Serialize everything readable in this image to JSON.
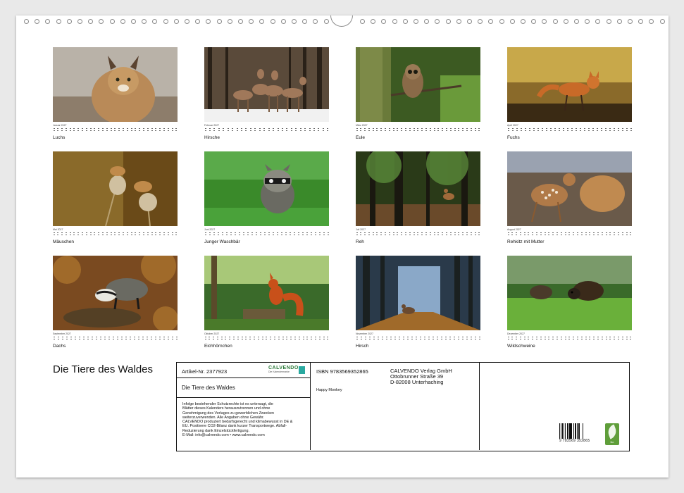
{
  "calendar": {
    "title": "Die Tiere des Waldes",
    "months": [
      {
        "month": "Januar 2027",
        "caption": "Luchs",
        "icon": "lynx-photo"
      },
      {
        "month": "Februar 2027",
        "caption": "Hirsche",
        "icon": "deer-group-photo"
      },
      {
        "month": "März 2027",
        "caption": "Eule",
        "icon": "owl-photo"
      },
      {
        "month": "April 2027",
        "caption": "Fuchs",
        "icon": "fox-photo"
      },
      {
        "month": "Mai 2027",
        "caption": "Mäuschen",
        "icon": "mice-photo"
      },
      {
        "month": "Juni 2027",
        "caption": "Junger Waschbär",
        "icon": "raccoon-photo"
      },
      {
        "month": "Juli 2027",
        "caption": "Reh",
        "icon": "roe-deer-photo"
      },
      {
        "month": "August 2027",
        "caption": "Rehkitz mit Mutter",
        "icon": "fawn-photo"
      },
      {
        "month": "September 2027",
        "caption": "Dachs",
        "icon": "badger-photo"
      },
      {
        "month": "Oktober 2027",
        "caption": "Eichhörnchen",
        "icon": "squirrel-photo"
      },
      {
        "month": "November 2027",
        "caption": "Hirsch",
        "icon": "stag-photo"
      },
      {
        "month": "Dezember 2027",
        "caption": "Wildschweine",
        "icon": "wild-boar-photo"
      }
    ]
  },
  "info": {
    "article": "Artikel-Nr. 2377923",
    "product_title": "Die Tiere des Waldes",
    "logo": "CALVENDO",
    "logo_sub": "Die Kalendermarke",
    "isbn": "ISBN 9783569352865",
    "author": "Happy Monkey",
    "publisher": [
      "CALVENDO Verlag GmbH",
      "Ottobrunner Straße 39",
      "D-82008 Unterhaching"
    ],
    "legal": [
      "Infolge bestehender Schutzrechte ist es untersagt, die",
      "Blätter dieses Kalenders herauszutrennen und ohne",
      "Genehmigung des Verlages zu gewerblichen Zwecken",
      "weiterzuverwenden. Alle Angaben ohne Gewähr.",
      "CALVENDO produziert bedarfsgerecht und klimabewusst in DE &",
      "EU. Positivere CO2-Bilanz dank kurzer Transportwege. Abfall-",
      "Reduzierung dank Einzelstückfertigung.",
      "E-Mail: info@calvendo.com • www.calvendo.com"
    ],
    "barcode_number": "9 783569 352865",
    "fsc_label": "fsc"
  }
}
